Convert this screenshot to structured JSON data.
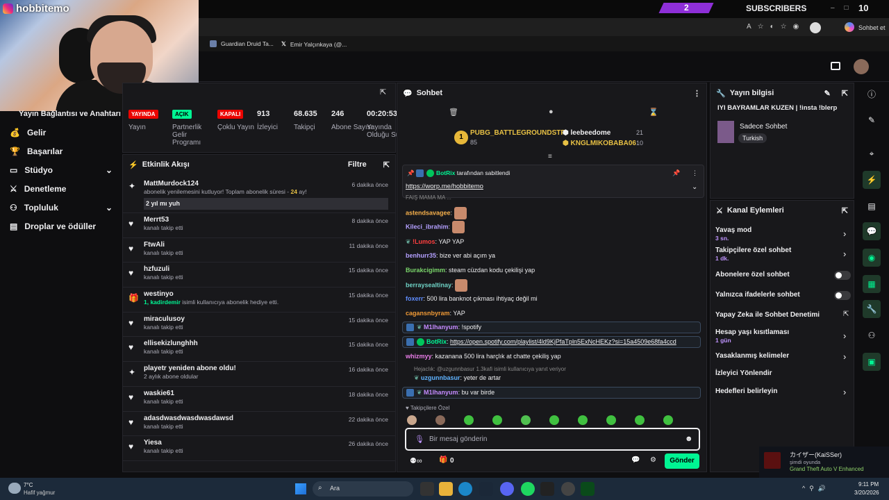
{
  "overlay": {
    "instagram_handle": "hobbitemo",
    "subscribers_count": "2",
    "subscribers_label": "SUBSCRIBERS",
    "counter": "10"
  },
  "browser": {
    "right_label": "Sohbet et",
    "tabs": [
      "Guardian Druid Ta...",
      "Emir Yalçınkaya (@..."
    ]
  },
  "leftnav": {
    "partial_title": "Yayın Bağlantısı ve Anahtarı",
    "items": [
      {
        "label": "Gelir",
        "icon": "money-icon",
        "chev": false
      },
      {
        "label": "Başarılar",
        "icon": "trophy-icon",
        "chev": false
      },
      {
        "label": "Stüdyo",
        "icon": "monitor-icon",
        "chev": true
      },
      {
        "label": "Denetleme",
        "icon": "sword-icon",
        "chev": false
      },
      {
        "label": "Topluluk",
        "icon": "people-icon",
        "chev": true
      },
      {
        "label": "Droplar ve ödüller",
        "icon": "drops-icon",
        "chev": false
      }
    ]
  },
  "stats": [
    {
      "value": "YAYINDA",
      "label": "Yayın",
      "badge": true,
      "color": "#eb0400",
      "fg": "#ffffff"
    },
    {
      "value": "AÇIK",
      "label": "Partnerlik Gelir Programı",
      "badge": true,
      "color": "#00f593",
      "fg": "#000000"
    },
    {
      "value": "KAPALI",
      "label": "Çoklu Yayın",
      "badge": true,
      "color": "#eb0400",
      "fg": "#ffffff"
    },
    {
      "value": "913",
      "label": "İzleyici",
      "badge": false
    },
    {
      "value": "68.635",
      "label": "Takipçi",
      "badge": false
    },
    {
      "value": "246",
      "label": "Abone Sayısı",
      "badge": false
    },
    {
      "value": "00:20:53",
      "label": "Yayında Olduğu Süre",
      "badge": false
    }
  ],
  "feed": {
    "title": "Etkinlik Akışı",
    "filter": "Filtre",
    "first": {
      "name": "MattMurdock124",
      "sub_prefix": "abonelik yenilemesini kutluyor! Toplam abonelik süresi - ",
      "months": "24",
      "suffix": " ay!",
      "time": "6 dakika önce",
      "message": "2 yıl mı yuh"
    },
    "items": [
      {
        "name": "Merrt53",
        "sub": "kanalı takip etti",
        "time": "8 dakika önce",
        "icon": "heart-icon"
      },
      {
        "name": "FtwAli",
        "sub": "kanalı takip etti",
        "time": "11 dakika önce",
        "icon": "heart-icon"
      },
      {
        "name": "hzfuzuli",
        "sub": "kanalı takip etti",
        "time": "15 dakika önce",
        "icon": "heart-icon"
      },
      {
        "name": "westinyo",
        "sub_highlight": "1, kadirdemir",
        "sub": " isimli kullanıcıya abonelik hediye etti.",
        "time": "15 dakika önce",
        "icon": "gift-icon"
      },
      {
        "name": "miraculusoy",
        "sub": "kanalı takip etti",
        "time": "15 dakika önce",
        "icon": "heart-icon"
      },
      {
        "name": "ellisekizlunghhh",
        "sub": "kanalı takip etti",
        "time": "15 dakika önce",
        "icon": "heart-icon"
      },
      {
        "name": "playetr yeniden abone oldu!",
        "sub": "2 aylık abone oldular",
        "time": "16 dakika önce",
        "icon": "star-icon"
      },
      {
        "name": "waskie61",
        "sub": "kanalı takip etti",
        "time": "18 dakika önce",
        "icon": "heart-icon"
      },
      {
        "name": "adasdwasdwasdwasdawsd",
        "sub": "kanalı takip etti",
        "time": "22 dakika önce",
        "icon": "heart-icon"
      },
      {
        "name": "Yiesa",
        "sub": "kanalı takip etti",
        "time": "26 dakika önce",
        "icon": "heart-icon"
      }
    ]
  },
  "chat": {
    "title": "Sohbet",
    "leaders": {
      "first_name": "PUBG_BATTLEGROUNDSTR",
      "first_score": "85",
      "second_name": "leebeedome",
      "second_score": "21",
      "third_name": "KNGLMIKOBABA06",
      "third_score": "10"
    },
    "pinned": {
      "by_user": "BotRix",
      "by_text": "tarafından sabitlendi",
      "link": "https://worp.me/hobbitemo"
    },
    "partial_top": "FAIŞ MAMA MA ...",
    "messages": [
      {
        "user": "astendsavagee",
        "text": "",
        "emote": true,
        "color": "#f6b04b"
      },
      {
        "user": "Kileci_ibrahim",
        "text": "",
        "emote": true,
        "color": "#b4a0ff"
      },
      {
        "user": "!Lumos",
        "text": "YAP YAP",
        "color": "#ff3f3f"
      },
      {
        "user": "benhurr35",
        "text": "bize ver abi açım ya",
        "color": "#b4a0ff"
      },
      {
        "user": "Burakcigimm",
        "text": "steam cüzdan kodu çekilişi yap",
        "color": "#7bd66b"
      },
      {
        "user": "berraysealtinay",
        "text": "",
        "emote": true,
        "color": "#6fd3c6"
      },
      {
        "user": "foxerr",
        "text": "500 lira banknot çıkması ihtiyaç değil mi",
        "color": "#5f8dff"
      },
      {
        "user": "cagansnbyram",
        "text": "YAP",
        "color": "#f09a36"
      },
      {
        "user": "M1lhanyum",
        "text": "!spotify",
        "color": "#c58bff"
      },
      {
        "user": "BotRix",
        "text": "https://open.spotify.com/playlist/4ld9KjPfaTpln5ExNcHEKz?si=15a4509e68fa4ccd",
        "color": "#00f593"
      },
      {
        "user": "whizmyy",
        "text": "kazanana 500 lira harçlık at chatte çekiliş yap",
        "color": "#e97de8"
      },
      {
        "reply": "Hejaclık: @uzgunnbasur 1.3kafi isimli kullanıcıya yanıt veriyor"
      },
      {
        "user": "uzgunnbasur",
        "text": "yeter de artar",
        "color": "#5fb3ff"
      },
      {
        "user": "M1lhanyum",
        "text": "bu var birde",
        "color": "#c58bff"
      }
    ],
    "follower_only": "Takipçilere Özel",
    "input_placeholder": "Bir mesaj gönderin",
    "points": "0",
    "send_label": "Gönder"
  },
  "info": {
    "title": "Yayın bilgisi",
    "stream_title": "IYI BAYRAMLAR KUZEN | !insta !blerp",
    "category": "Sadece Sohbet",
    "tag": "Turkish"
  },
  "actions": {
    "title": "Kanal Eylemleri",
    "items": [
      {
        "label": "Yavaş mod",
        "sub": "3 sn.",
        "control": "arrow"
      },
      {
        "label": "Takipçilere özel sohbet",
        "sub": "1 dk.",
        "control": "arrow"
      },
      {
        "label": "Abonelere özel sohbet",
        "control": "toggle"
      },
      {
        "label": "Yalnızca ifadelerle sohbet",
        "control": "toggle"
      },
      {
        "label": "Yapay Zeka ile Sohbet Denetimi",
        "control": "external"
      },
      {
        "label": "Hesap yaşı kısıtlaması",
        "sub": "1 gün",
        "control": "arrow"
      },
      {
        "label": "Yasaklanmış kelimeler",
        "control": "arrow"
      },
      {
        "label": "İzleyici Yönlendir",
        "control": "none"
      },
      {
        "label": "Hedefleri belirleyin",
        "control": "arrow"
      }
    ]
  },
  "notification": {
    "name": "カイザー(KaiSSer)",
    "status": "şimdi oyunda",
    "game": "Grand Theft Auto V Enhanced"
  },
  "taskbar": {
    "temp": "7°C",
    "weather": "Hafif yağmur",
    "search": "Ara",
    "time": "9:11 PM",
    "date": "3/20/2026"
  },
  "colors": {
    "accent": "#00f593",
    "live": "#eb0400",
    "sub": "#8e2fd8"
  }
}
